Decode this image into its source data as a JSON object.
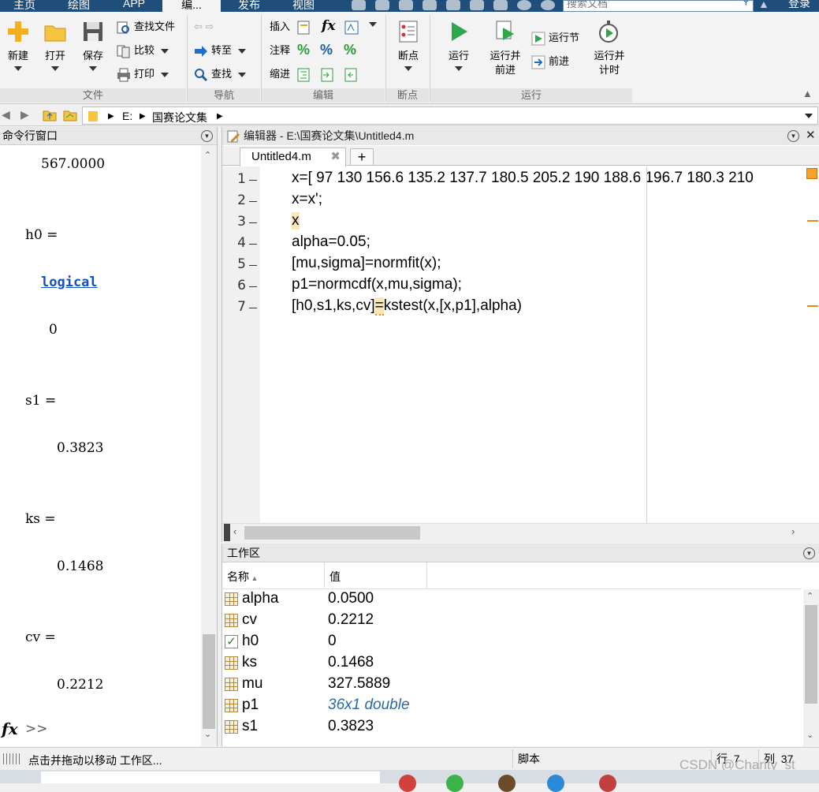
{
  "top_tabs": [
    "主页",
    "绘图",
    "APP",
    "编...",
    "发布",
    "视图"
  ],
  "search_placeholder": "搜索文档",
  "login": "登录",
  "ribbon": {
    "file_group": {
      "label": "文件",
      "new": "新建",
      "open": "打开",
      "save": "保存",
      "find_files": "查找文件",
      "compare": "比较",
      "print": "打印"
    },
    "nav_group": {
      "label": "导航",
      "goto": "转至",
      "find": "查找"
    },
    "edit_group": {
      "label": "编辑",
      "insert": "插入",
      "comment": "注释",
      "indent": "缩进",
      "fx": "fx"
    },
    "bp_group": {
      "label": "断点",
      "breakpoints": "断点"
    },
    "run_group": {
      "label": "运行",
      "run": "运行",
      "run_advance_1": "运行并",
      "run_advance_2": "前进",
      "run_section": "运行节",
      "advance": "前进",
      "run_time_1": "运行并",
      "run_time_2": "计时"
    }
  },
  "path": {
    "drive": "E:",
    "folder": "国赛论文集"
  },
  "cmd": {
    "title": "命令行窗口",
    "lines": [
      {
        "text": "567.0000"
      },
      {
        "text": "h0 ="
      },
      {
        "text": "logical"
      },
      {
        "text": "0"
      },
      {
        "text": "s1 ="
      },
      {
        "text": "0.3823"
      },
      {
        "text": "ks ="
      },
      {
        "text": "0.1468"
      },
      {
        "text": "cv ="
      },
      {
        "text": "0.2212"
      }
    ],
    "prompt": ">>",
    "fx": "fx"
  },
  "editor": {
    "title": "编辑器 - E:\\国赛论文集\\Untitled4.m",
    "tab": "Untitled4.m",
    "lines": [
      {
        "num": "1",
        "text": "x=[ 97 130 156.6 135.2 137.7 180.5 205.2 190 188.6 196.7 180.3 210"
      },
      {
        "num": "2",
        "text": "x=x';"
      },
      {
        "num": "3",
        "text": "x"
      },
      {
        "num": "4",
        "text": "alpha=0.05;"
      },
      {
        "num": "5",
        "text": "[mu,sigma]=normfit(x);"
      },
      {
        "num": "6",
        "text": "p1=normcdf(x,mu,sigma);"
      },
      {
        "num": "7a",
        "text": "[h0,s1,ks,cv]"
      },
      {
        "num": "7b",
        "text": "="
      },
      {
        "num": "7c",
        "text": "kstest(x,[x,p1],alpha)"
      }
    ]
  },
  "workspace": {
    "title": "工作区",
    "col_name": "名称",
    "col_value": "值",
    "rows": [
      {
        "name": "alpha",
        "value": "0.0500"
      },
      {
        "name": "cv",
        "value": "0.2212"
      },
      {
        "name": "h0",
        "value": "0"
      },
      {
        "name": "ks",
        "value": "0.1468"
      },
      {
        "name": "mu",
        "value": "327.5889"
      },
      {
        "name": "p1",
        "value": "36x1 double"
      },
      {
        "name": "s1",
        "value": "0.3823"
      }
    ]
  },
  "status": {
    "message": "点击并拖动以移动 工作区...",
    "mode": "脚本",
    "row_label": "行",
    "row": "7",
    "col_label": "列",
    "col": "37"
  },
  "watermark": "CSDN @Charity_st"
}
